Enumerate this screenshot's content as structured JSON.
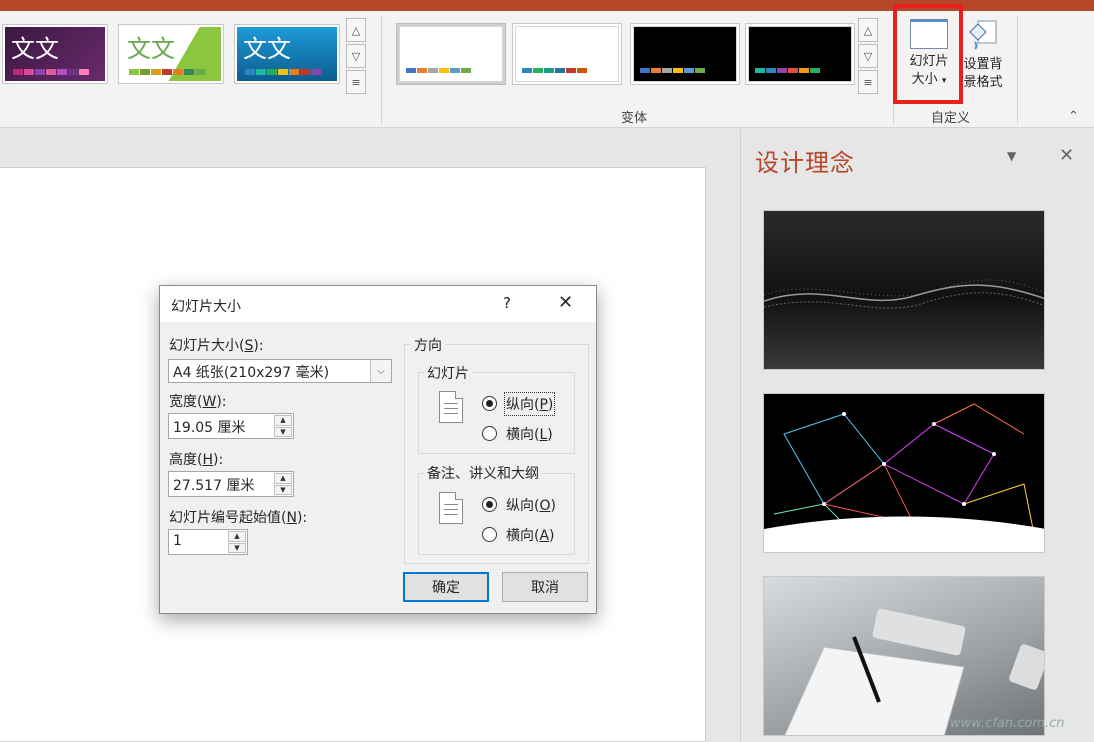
{
  "ribbon": {
    "themes": [
      {
        "text": "文文",
        "colors": [
          "#c0277a",
          "#d64a9a",
          "#8e44ad",
          "#e05aa0",
          "#b54fc1",
          "#6c3483",
          "#ff7fbf"
        ]
      },
      {
        "text": "文文",
        "colors": [
          "#8cc63f",
          "#7a9c2e",
          "#d4a017",
          "#c0392b",
          "#e67e22",
          "#2e8b57",
          "#6aa84f"
        ]
      },
      {
        "text": "文文",
        "colors": [
          "#2e86c1",
          "#1abc9c",
          "#27ae60",
          "#f1c40f",
          "#e67e22",
          "#c0392b",
          "#8e44ad"
        ]
      }
    ],
    "variants": [
      {
        "bg": "#ffffff",
        "colors": [
          "#4472c4",
          "#ed7d31",
          "#a5a5a5",
          "#ffc000",
          "#5b9bd5",
          "#70ad47"
        ]
      },
      {
        "bg": "#ffffff",
        "colors": [
          "#2e86c1",
          "#27ae60",
          "#16a085",
          "#2471a3",
          "#c0392b",
          "#d35400"
        ]
      },
      {
        "bg": "#000000",
        "colors": [
          "#4472c4",
          "#ed7d31",
          "#a5a5a5",
          "#ffc000",
          "#5b9bd5",
          "#70ad47"
        ]
      },
      {
        "bg": "#000000",
        "colors": [
          "#1abc9c",
          "#2e86c1",
          "#8e44ad",
          "#e74c3c",
          "#f39c12",
          "#27ae60"
        ]
      }
    ],
    "variants_group_label": "变体",
    "customize_group_label": "自定义",
    "slide_size_label_line1": "幻灯片",
    "slide_size_label_line2": "大小",
    "bg_format_label_line1": "设置背",
    "bg_format_label_line2": "景格式"
  },
  "design_pane": {
    "title": "设计理念"
  },
  "dialog": {
    "title": "幻灯片大小",
    "help": "?",
    "slide_size_label": "幻灯片大小(",
    "slide_size_key": "S",
    "slide_size_value": "A4 纸张(210x297 毫米)",
    "width_label": "宽度(",
    "width_key": "W",
    "width_value": "19.05 厘米",
    "height_label": "高度(",
    "height_key": "H",
    "height_value": "27.517 厘米",
    "numbering_label": "幻灯片编号起始值(",
    "numbering_key": "N",
    "numbering_value": "1",
    "orientation_label": "方向",
    "slides_group": "幻灯片",
    "slides_portrait": "纵向(",
    "slides_portrait_key": "P",
    "slides_landscape": "横向(",
    "slides_landscape_key": "L",
    "notes_group": "备注、讲义和大纲",
    "notes_portrait": "纵向(",
    "notes_portrait_key": "O",
    "notes_landscape": "横向(",
    "notes_landscape_key": "A",
    "ok": "确定",
    "cancel": "取消"
  },
  "watermark": "www.cfan.com.cn"
}
